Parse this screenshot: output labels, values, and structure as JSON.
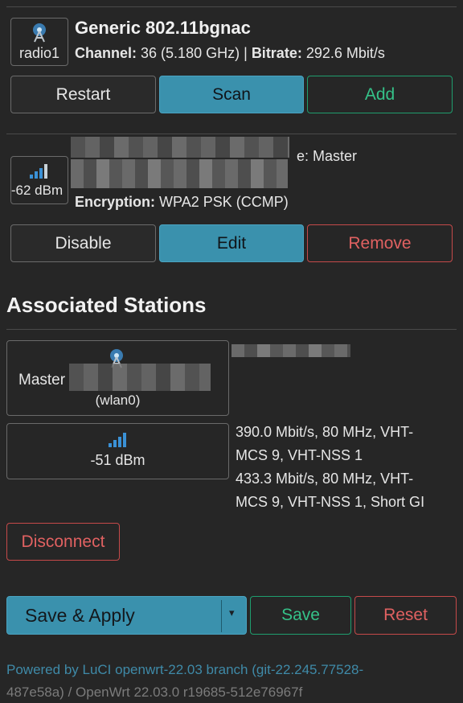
{
  "radio": {
    "iface_label": "radio1",
    "name": "Generic 802.11bgnac",
    "channel_label": "Channel:",
    "channel_value": "36 (5.180 GHz)",
    "sep": "|",
    "bitrate_label": "Bitrate:",
    "bitrate_value": "292.6 Mbit/s",
    "buttons": {
      "restart": "Restart",
      "scan": "Scan",
      "add": "Add"
    }
  },
  "network": {
    "signal": "-62 dBm",
    "mode_suffix": "e: Master",
    "encryption_label": "Encryption:",
    "encryption_value": "WPA2 PSK (CCMP)",
    "buttons": {
      "disable": "Disable",
      "edit": "Edit",
      "remove": "Remove"
    }
  },
  "stations": {
    "heading": "Associated Stations",
    "master_label": "Master",
    "iface": "(wlan0)",
    "signal": "-51 dBm",
    "rate_rx": "390.0 Mbit/s, 80 MHz, VHT-MCS 9, VHT-NSS 1",
    "rate_rx_l1": "390.0 Mbit/s, 80 MHz, VHT-",
    "rate_rx_l2": "MCS 9, VHT-NSS 1",
    "rate_tx_l1": "433.3 Mbit/s, 80 MHz, VHT-",
    "rate_tx_l2": "MCS 9, VHT-NSS 1, Short GI",
    "disconnect": "Disconnect"
  },
  "actions": {
    "save_apply": "Save & Apply",
    "dropdown_caret": "▾",
    "save": "Save",
    "reset": "Reset"
  },
  "footer": {
    "line1": "Powered by LuCI openwrt-22.03 branch (git-22.245.77528-",
    "line2": "487e58a) / OpenWrt 22.03.0 r19685-512e76967f"
  },
  "colors": {
    "background": "#262626",
    "accent_blue": "#3a91ad",
    "positive_green": "#35c289",
    "negative_red": "#e06161",
    "link": "#3f8aa8"
  }
}
